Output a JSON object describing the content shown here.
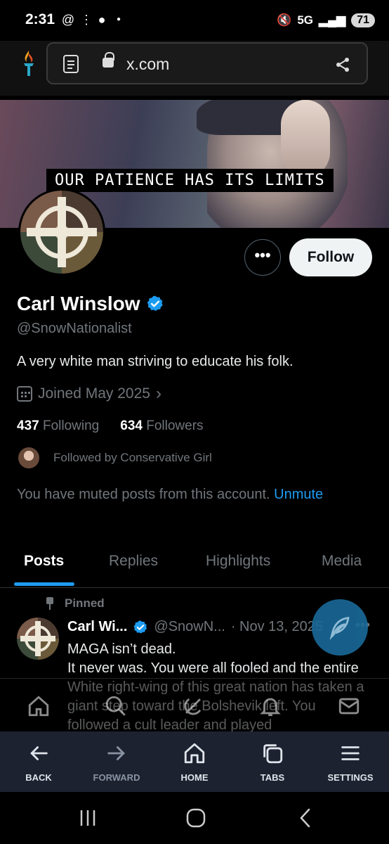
{
  "status_bar": {
    "time": "2:31",
    "network": "5G",
    "battery": "71"
  },
  "browser": {
    "url": "x.com",
    "bottom_nav": [
      {
        "label": "BACK",
        "icon": "arrow-left-icon"
      },
      {
        "label": "FORWARD",
        "icon": "arrow-right-icon"
      },
      {
        "label": "HOME",
        "icon": "home-icon"
      },
      {
        "label": "TABS",
        "icon": "tabs-icon"
      },
      {
        "label": "SETTINGS",
        "icon": "menu-icon"
      }
    ]
  },
  "banner": {
    "caption": "OUR PATIENCE HAS ITS LIMITS"
  },
  "profile": {
    "more_label": "•••",
    "follow_label": "Follow",
    "name": "Carl Winslow",
    "handle": "@SnowNationalist",
    "bio": "A very white man striving to educate his folk.",
    "joined": "Joined May 2025",
    "following_count": "437",
    "following_label": "Following",
    "followers_count": "634",
    "followers_label": "Followers",
    "followed_by": "Followed by Conservative Girl",
    "muted_text": "You have muted posts from this account.",
    "unmute_label": "Unmute"
  },
  "tabs": [
    "Posts",
    "Replies",
    "Highlights",
    "Media"
  ],
  "post": {
    "pinned_label": "Pinned",
    "author_name": "Carl Wi...",
    "author_handle": "@SnowN...",
    "date": "· Nov 13, 2025",
    "more": "•••",
    "lines": [
      "MAGA isn’t dead.",
      "It never was. You were all fooled and the entire White right-wing of this great nation has taken a giant step toward the Bolshevik left. You followed a cult leader and played"
    ]
  },
  "colors": {
    "accent": "#1d9bf0",
    "muted_text": "#71767b",
    "browser_bar": "#1c2230"
  }
}
